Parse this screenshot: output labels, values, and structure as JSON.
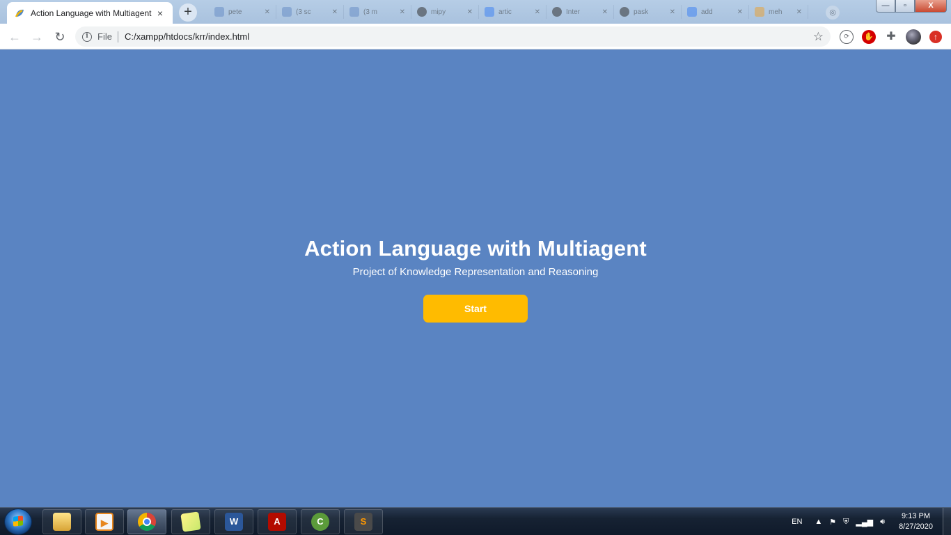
{
  "browser": {
    "active_tab": {
      "title": "Action Language with Multiagent",
      "close_icon": "×"
    },
    "new_tab_icon": "+",
    "background_tabs": [
      {
        "label": "pete",
        "color": "#6a8fc7"
      },
      {
        "label": "(3 sc",
        "color": "#6a8fc7"
      },
      {
        "label": "(3 m",
        "color": "#6a8fc7"
      },
      {
        "label": "mipy",
        "color": "#333333"
      },
      {
        "label": "artic",
        "color": "#4285f4"
      },
      {
        "label": "Inter",
        "color": "#333333"
      },
      {
        "label": "pask",
        "color": "#333333"
      },
      {
        "label": "add",
        "color": "#4285f4"
      },
      {
        "label": "meh",
        "color": "#e8a33b"
      }
    ],
    "window_controls": {
      "minimize": "—",
      "maximize": "▫",
      "close": "X"
    },
    "toolbar": {
      "back_icon": "←",
      "forward_icon": "→",
      "reload_icon": "↻",
      "scheme": "File",
      "url": "C:/xampp/htdocs/krr/index.html",
      "bookmark_icon": "☆"
    }
  },
  "page": {
    "title": "Action Language with Multiagent",
    "subtitle": "Project of Knowledge Representation and Reasoning",
    "start_button": "Start",
    "background_color": "#5a84c2",
    "button_color": "#ffbb00"
  },
  "taskbar": {
    "apps": [
      {
        "name": "explorer",
        "glyph": ""
      },
      {
        "name": "media-player",
        "glyph": "▶"
      },
      {
        "name": "chrome",
        "glyph": ""
      },
      {
        "name": "sticky-notes",
        "glyph": ""
      },
      {
        "name": "word",
        "glyph": "W"
      },
      {
        "name": "acrobat",
        "glyph": "A"
      },
      {
        "name": "coreldraw",
        "glyph": "C"
      },
      {
        "name": "sublime-text",
        "glyph": "S"
      }
    ],
    "language": "EN",
    "tray_arrow": "▲",
    "time": "9:13 PM",
    "date": "8/27/2020"
  }
}
